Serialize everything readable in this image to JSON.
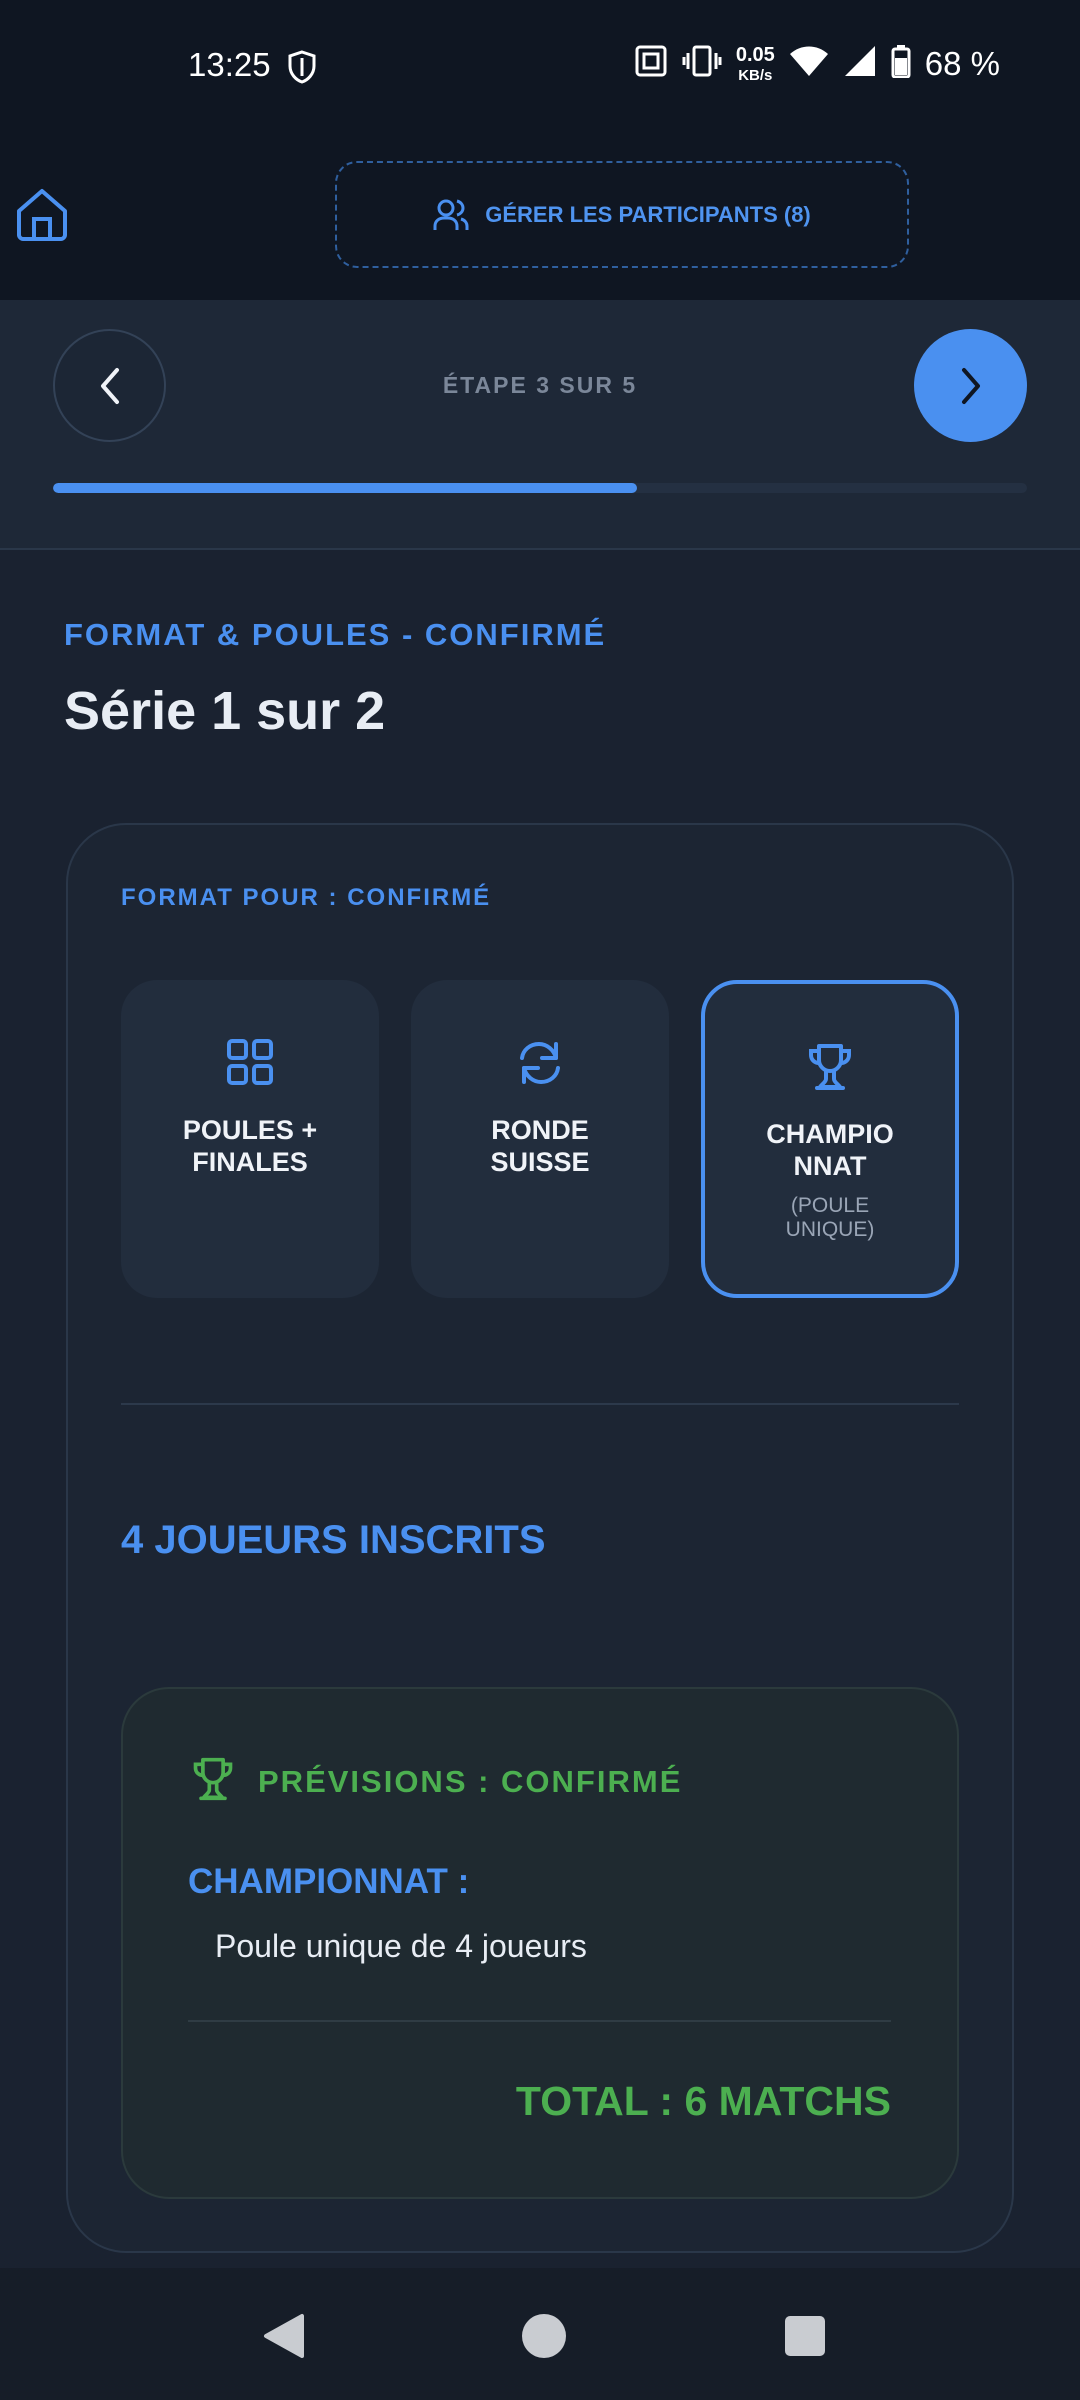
{
  "status_bar": {
    "time": "13:25",
    "net_speed_value": "0.05",
    "net_speed_unit": "KB/s",
    "battery": "68 %"
  },
  "header": {
    "manage_participants_label": "GÉRER LES PARTICIPANTS (8)"
  },
  "stepper": {
    "label": "ÉTAPE 3 SUR 5",
    "progress_fraction": 0.6
  },
  "section": {
    "kicker": "FORMAT & POULES - CONFIRMÉ",
    "title": "Série 1 sur 2"
  },
  "format_card": {
    "kicker": "FORMAT POUR : CONFIRMÉ",
    "options": [
      {
        "label": "POULES +\nFINALES",
        "sub": "",
        "icon": "grid-icon",
        "selected": false
      },
      {
        "label": "RONDE\nSUISSE",
        "sub": "",
        "icon": "refresh-icon",
        "selected": false
      },
      {
        "label": "CHAMPIO\nNNAT",
        "sub": "(POULE\nUNIQUE)",
        "icon": "trophy-icon",
        "selected": true
      }
    ],
    "players_count": "4 JOUEURS INSCRITS"
  },
  "prediction": {
    "title": "PRÉVISIONS : CONFIRMÉ",
    "type": "CHAMPIONNAT :",
    "description": "Poule unique de 4 joueurs",
    "total": "TOTAL : 6 MATCHS"
  },
  "colors": {
    "accent": "#4a90f0",
    "success": "#4caf50",
    "background": "#1a2230"
  }
}
